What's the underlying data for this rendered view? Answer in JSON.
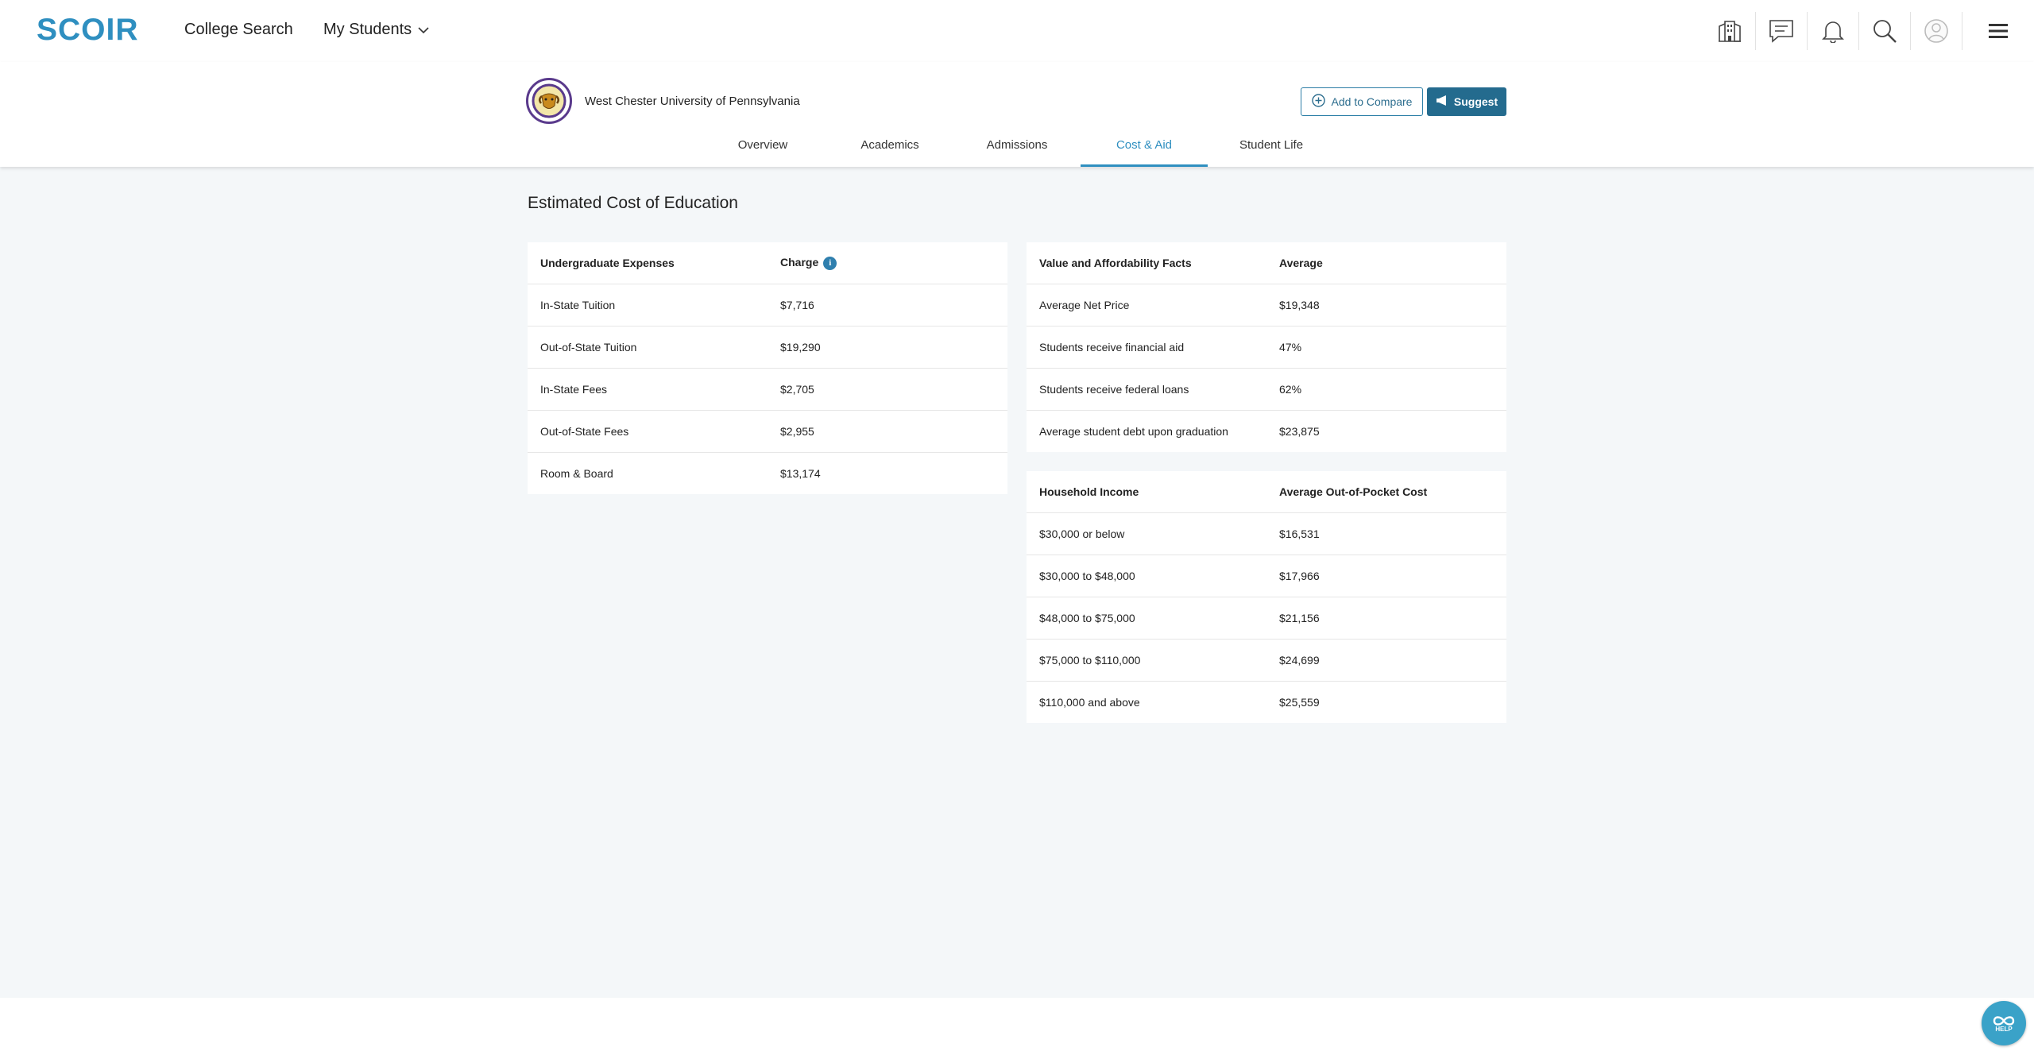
{
  "nav": {
    "logo": "SCOIR",
    "college_search": "College Search",
    "my_students": "My Students",
    "icons": [
      "colleges-icon",
      "messages-icon",
      "bell-icon",
      "search-icon",
      "avatar-icon",
      "menu-icon"
    ]
  },
  "college": {
    "name": "West Chester University of Pennsylvania",
    "add_to_compare": "Add to Compare",
    "suggest": "Suggest"
  },
  "tabs": [
    {
      "label": "Overview"
    },
    {
      "label": "Academics"
    },
    {
      "label": "Admissions"
    },
    {
      "label": "Cost & Aid",
      "active": true
    },
    {
      "label": "Student Life"
    }
  ],
  "main": {
    "title": "Estimated Cost of Education",
    "expenses": {
      "headers": [
        "Undergraduate Expenses",
        "Charge"
      ],
      "rows": [
        [
          "In-State Tuition",
          "$7,716"
        ],
        [
          "Out-of-State Tuition",
          "$19,290"
        ],
        [
          "In-State Fees",
          "$2,705"
        ],
        [
          "Out-of-State Fees",
          "$2,955"
        ],
        [
          "Room & Board",
          "$13,174"
        ]
      ]
    },
    "facts": {
      "headers": [
        "Value and Affordability Facts",
        "Average"
      ],
      "rows": [
        [
          "Average Net Price",
          "$19,348"
        ],
        [
          "Students receive financial aid",
          "47%"
        ],
        [
          "Students receive federal loans",
          "62%"
        ],
        [
          "Average student debt upon graduation",
          "$23,875"
        ]
      ]
    },
    "income": {
      "headers": [
        "Household Income",
        "Average Out-of-Pocket Cost"
      ],
      "rows": [
        [
          "$30,000 or below",
          "$16,531"
        ],
        [
          "$30,000 to $48,000",
          "$17,966"
        ],
        [
          "$48,000 to $75,000",
          "$21,156"
        ],
        [
          "$75,000 to $110,000",
          "$24,699"
        ],
        [
          "$110,000 and above",
          "$25,559"
        ]
      ]
    }
  },
  "help": {
    "label": "HELP"
  },
  "colors": {
    "brand": "#2f8fc0",
    "button": "#246b8e",
    "background": "#f4f7f9"
  }
}
